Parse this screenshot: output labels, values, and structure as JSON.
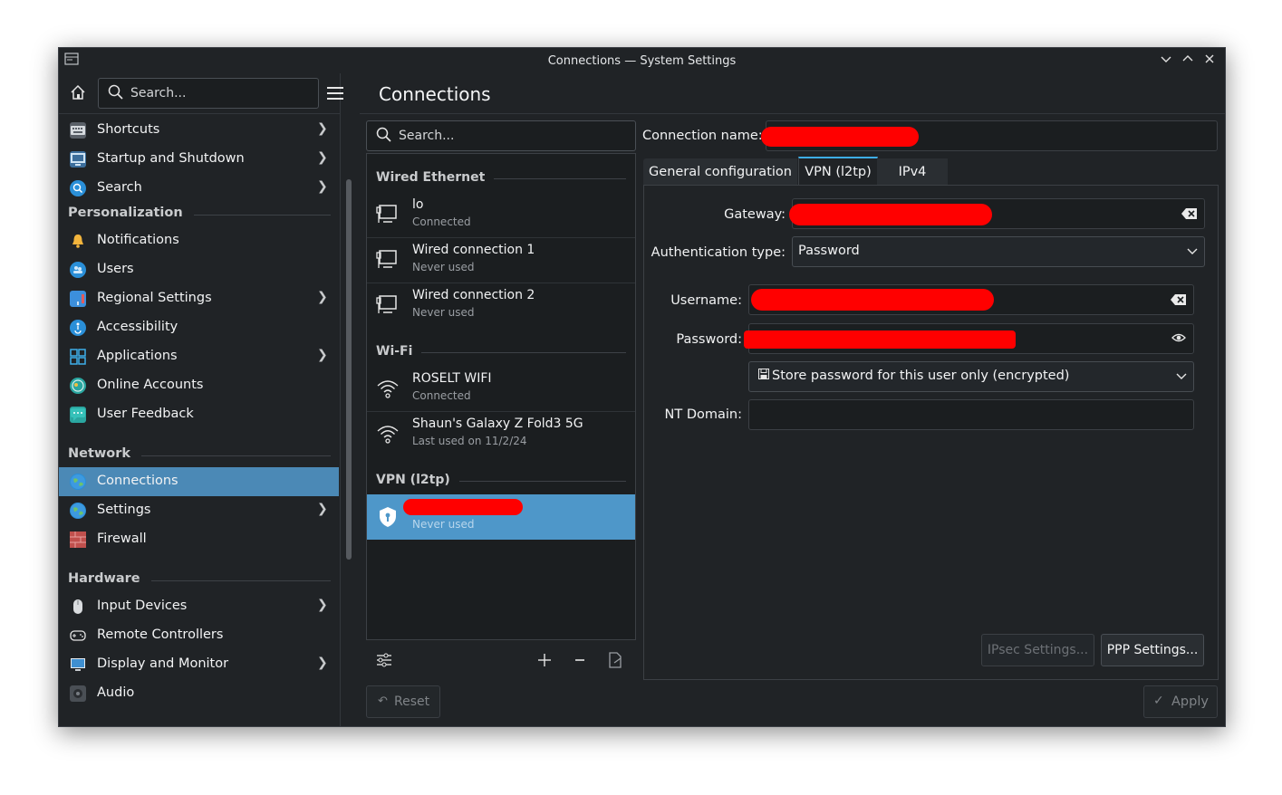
{
  "window": {
    "title": "Connections — System Settings"
  },
  "sidebar": {
    "search_placeholder": "Search...",
    "items": [
      {
        "label": "Shortcuts",
        "icon": "keyboard-icon",
        "chevron": true
      },
      {
        "label": "Startup and Shutdown",
        "icon": "startup-icon",
        "chevron": true
      },
      {
        "label": "Search",
        "icon": "search-globe-icon",
        "chevron": true
      }
    ],
    "sections": [
      {
        "heading": "Personalization",
        "items": [
          {
            "label": "Notifications",
            "icon": "bell-icon",
            "chevron": false
          },
          {
            "label": "Users",
            "icon": "users-icon",
            "chevron": false
          },
          {
            "label": "Regional Settings",
            "icon": "flag-icon",
            "chevron": true
          },
          {
            "label": "Accessibility",
            "icon": "accessibility-icon",
            "chevron": false
          },
          {
            "label": "Applications",
            "icon": "applications-icon",
            "chevron": true
          },
          {
            "label": "Online Accounts",
            "icon": "online-accounts-icon",
            "chevron": false
          },
          {
            "label": "User Feedback",
            "icon": "feedback-icon",
            "chevron": false
          }
        ]
      },
      {
        "heading": "Network",
        "items": [
          {
            "label": "Connections",
            "icon": "globe-icon",
            "chevron": false,
            "selected": true
          },
          {
            "label": "Settings",
            "icon": "globe-settings-icon",
            "chevron": true
          },
          {
            "label": "Firewall",
            "icon": "firewall-icon",
            "chevron": false
          }
        ]
      },
      {
        "heading": "Hardware",
        "items": [
          {
            "label": "Input Devices",
            "icon": "mouse-icon",
            "chevron": true
          },
          {
            "label": "Remote Controllers",
            "icon": "gamepad-icon",
            "chevron": false
          },
          {
            "label": "Display and Monitor",
            "icon": "monitor-icon",
            "chevron": true
          },
          {
            "label": "Audio",
            "icon": "speaker-icon",
            "chevron": false
          }
        ]
      }
    ]
  },
  "main": {
    "title": "Connections",
    "search_placeholder": "Search...",
    "groups": [
      {
        "heading": "Wired Ethernet",
        "items": [
          {
            "name": "lo",
            "status": "Connected",
            "icon": "wired-icon"
          },
          {
            "name": "Wired connection 1",
            "status": "Never used",
            "icon": "wired-icon"
          },
          {
            "name": "Wired connection 2",
            "status": "Never used",
            "icon": "wired-icon"
          }
        ]
      },
      {
        "heading": "Wi-Fi",
        "items": [
          {
            "name": "ROSELT WIFI",
            "status": "Connected",
            "icon": "wifi-icon"
          },
          {
            "name": "Shaun's Galaxy Z Fold3 5G",
            "status": "Last used on 11/2/24",
            "icon": "wifi-icon"
          }
        ]
      },
      {
        "heading": "VPN (l2tp)",
        "items": [
          {
            "name": "",
            "status": "Never used",
            "icon": "vpn-shield-icon",
            "selected": true
          }
        ]
      }
    ],
    "reset_label": "Reset",
    "apply_label": "Apply"
  },
  "editor": {
    "connection_name_label": "Connection name:",
    "tabs": [
      "General configuration",
      "VPN (l2tp)",
      "IPv4"
    ],
    "active_tab": "VPN (l2tp)",
    "gateway_label": "Gateway:",
    "auth_type_label": "Authentication type:",
    "auth_type_value": "Password",
    "username_label": "Username:",
    "password_label": "Password:",
    "password_storage_value": "Store password for this user only (encrypted)",
    "nt_domain_label": "NT Domain:",
    "ipsec_button": "IPsec Settings...",
    "ppp_button": "PPP Settings..."
  },
  "colors": {
    "accent": "#3daee9",
    "selection": "#4b89b6",
    "redaction": "#ff0000"
  }
}
